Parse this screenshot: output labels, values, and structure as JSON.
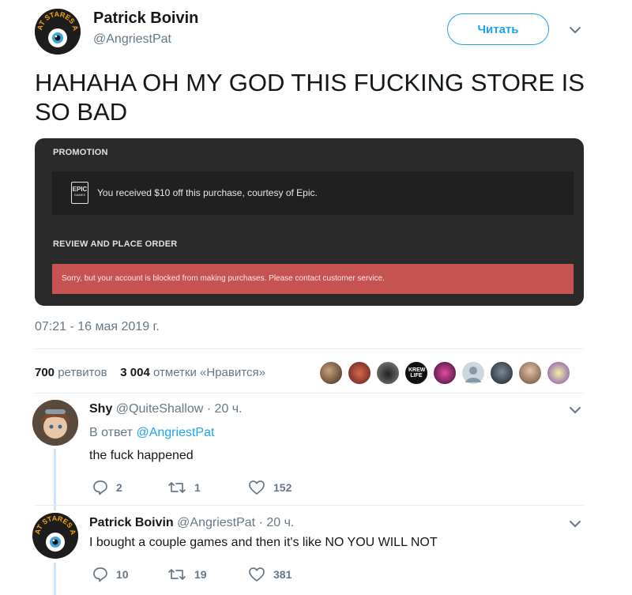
{
  "tweet": {
    "author_name": "Patrick Boivin",
    "author_handle": "@AngriestPat",
    "avatar_text": "PAT STARES AT",
    "follow_label": "Читать",
    "text": "HAHAHA OH MY GOD THIS FUCKING STORE IS SO BAD",
    "timestamp": "07:21 - 16 мая 2019 г.",
    "retweets_count": "700",
    "retweets_label": "ретвитов",
    "likes_count": "3 004",
    "likes_label": "отметки «Нравится»"
  },
  "card": {
    "promotion_heading": "PROMOTION",
    "epic_logo_top": "EPIC",
    "epic_logo_bottom": "GAMES",
    "promotion_text": "You received $10 off this purchase, courtesy of Epic.",
    "review_heading": "REVIEW AND PLACE ORDER",
    "error_text": "Sorry, but your account is blocked from making purchases. Please contact customer service."
  },
  "likers": {
    "badge_text": "KREW LIFE"
  },
  "replies": [
    {
      "name": "Shy",
      "handle": "@QuiteShallow",
      "time": "· 20 ч.",
      "reply_prefix": "В ответ",
      "reply_to": "@AngriestPat",
      "text": "the fuck happened",
      "replies": "2",
      "retweets": "1",
      "likes": "152"
    },
    {
      "name": "Patrick Boivin",
      "handle": "@AngriestPat",
      "time": "· 20 ч.",
      "text": "I bought a couple games and then it's like NO YOU WILL NOT",
      "replies": "10",
      "retweets": "19",
      "likes": "381"
    }
  ],
  "colors": {
    "accent": "#1da1f2",
    "error_bar": "#c65352",
    "card_bg": "#2a2a2a"
  }
}
